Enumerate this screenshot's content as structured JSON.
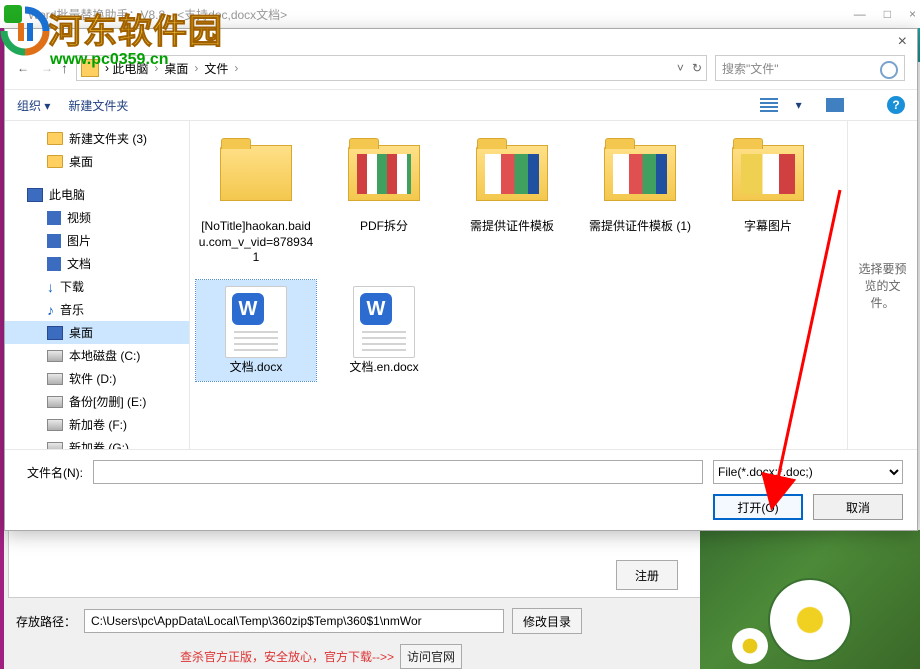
{
  "watermark": {
    "title": "河东软件园",
    "url": "www.pc0359.cn"
  },
  "app": {
    "title_parts": [
      "Word批量替换助手：V8.8＿<支持doc,docx文档>"
    ],
    "win": {
      "min": "—",
      "max": "□",
      "close": "×"
    }
  },
  "dialog": {
    "close": "×",
    "nav": {
      "back": "←",
      "fwd": "→",
      "up": "↑"
    },
    "breadcrumb": [
      "此电脑",
      "桌面",
      "文件"
    ],
    "crumb_sep": "›",
    "refresh": "↻",
    "dropdown": "˅",
    "search_placeholder": "搜索\"文件\"",
    "toolbar": {
      "organize": "组织 ▾",
      "newfolder": "新建文件夹",
      "view1": "",
      "view2": "",
      "help": "?"
    },
    "tree": [
      {
        "icon": "folder",
        "label": "新建文件夹 (3)",
        "lvl": 2
      },
      {
        "icon": "folder",
        "label": "桌面",
        "lvl": 2
      },
      {
        "spacer": true
      },
      {
        "icon": "pc",
        "label": "此电脑",
        "lvl": 1
      },
      {
        "icon": "media",
        "label": "视频",
        "lvl": 2
      },
      {
        "icon": "media",
        "label": "图片",
        "lvl": 2
      },
      {
        "icon": "media",
        "label": "文档",
        "lvl": 2
      },
      {
        "icon": "dl",
        "label": "下载",
        "lvl": 2
      },
      {
        "icon": "music",
        "label": "音乐",
        "lvl": 2
      },
      {
        "icon": "pc",
        "label": "桌面",
        "lvl": 2,
        "sel": true
      },
      {
        "icon": "drive",
        "label": "本地磁盘 (C:)",
        "lvl": 2
      },
      {
        "icon": "drive",
        "label": "软件 (D:)",
        "lvl": 2
      },
      {
        "icon": "drive",
        "label": "备份[勿删] (E:)",
        "lvl": 2
      },
      {
        "icon": "drive",
        "label": "新加卷 (F:)",
        "lvl": 2
      },
      {
        "icon": "drive",
        "label": "新加卷 (G:)",
        "lvl": 2
      }
    ],
    "files": [
      {
        "type": "folder",
        "thumb": "plain",
        "label": "[NoTitle]haokan.baidu.com_v_vid=8789341"
      },
      {
        "type": "folder",
        "thumb": "pdf",
        "label": "PDF拆分"
      },
      {
        "type": "folder",
        "thumb": "tpl",
        "label": "需提供证件模板"
      },
      {
        "type": "folder",
        "thumb": "tpl",
        "label": "需提供证件模板 (1)"
      },
      {
        "type": "folder",
        "thumb": "sub",
        "label": "字幕图片"
      },
      {
        "type": "docx",
        "label": "文档.docx",
        "sel": true
      },
      {
        "type": "docx",
        "label": "文档.en.docx"
      }
    ],
    "preview_text": "选择要预览的文件。",
    "filename_label": "文件名(N):",
    "filename_value": "",
    "filter": "File(*.docx;*.doc;)",
    "open": "打开(O)",
    "cancel": "取消"
  },
  "bg": {
    "register": "注册",
    "savepath_label": "存放路径：",
    "savepath_value": "C:\\Users\\pc\\AppData\\Local\\Temp\\360zip$Temp\\360$1\\nmWor",
    "change_dir": "修改目录",
    "foot_warn": "查杀官方正版，安全放心，官方下载-->>",
    "visit": "访问官网"
  }
}
